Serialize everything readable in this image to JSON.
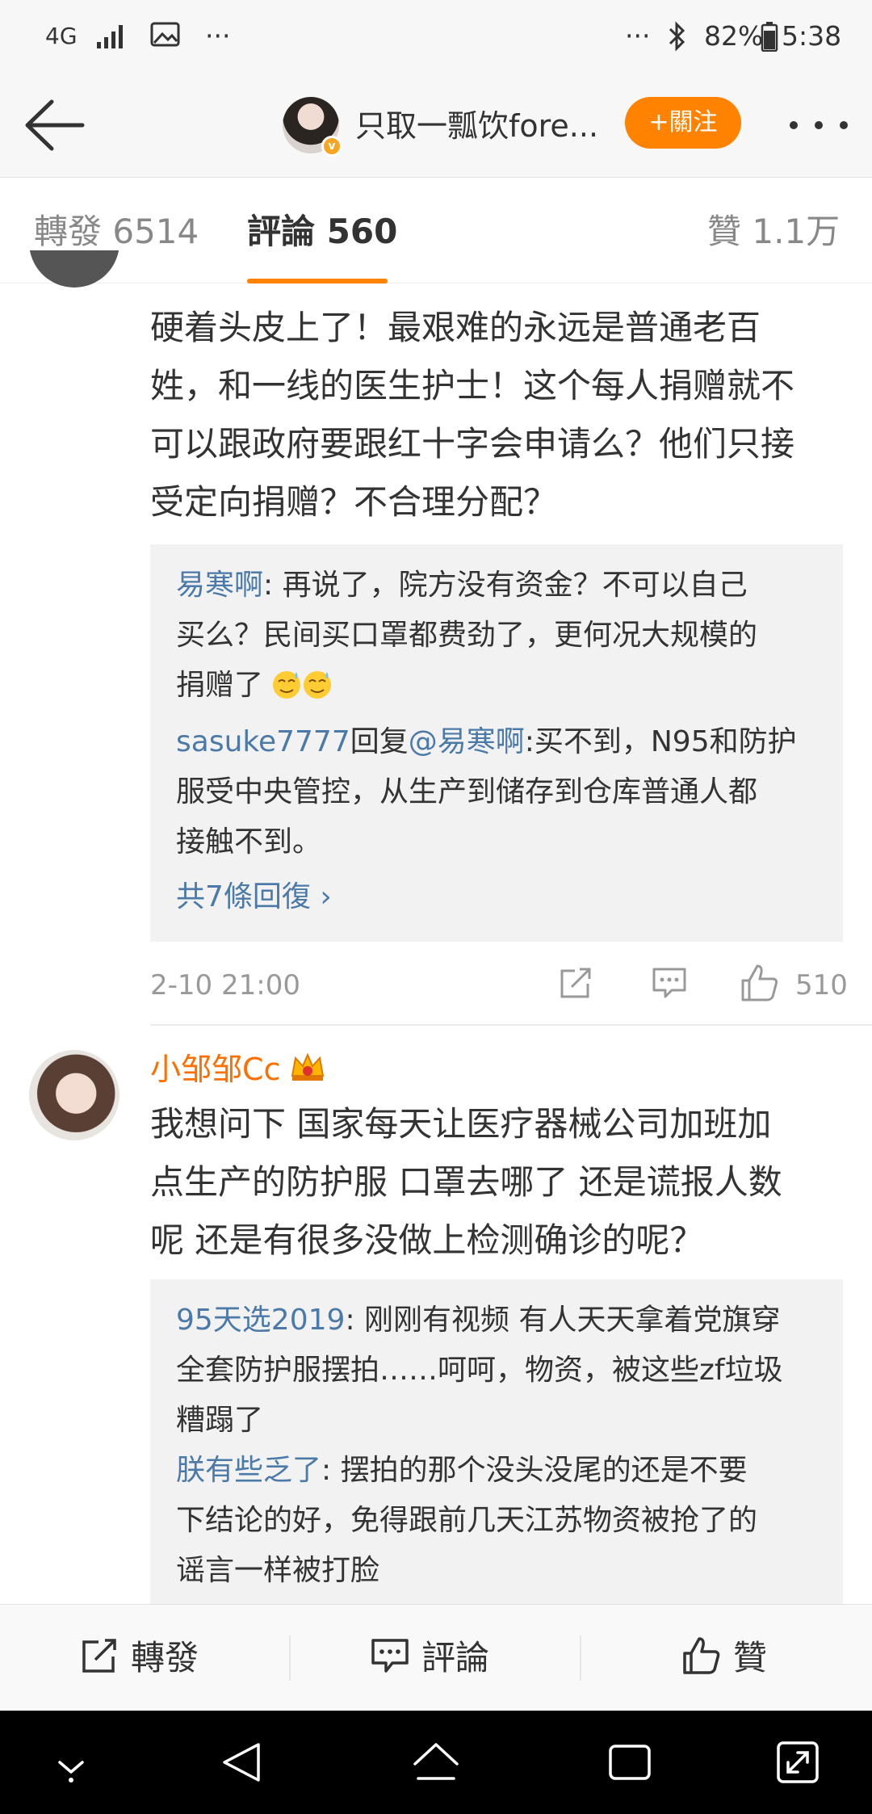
{
  "status_bar": {
    "network": "4G",
    "more_left": "···",
    "more_right": "···",
    "battery": "82%",
    "time": "5:38"
  },
  "header": {
    "title": "只取一瓢饮fore...",
    "follow_label": "+關注"
  },
  "tabs": {
    "repost": "轉發 6514",
    "comments": "評論 560",
    "likes": "贊 1.1万"
  },
  "comment1": {
    "lines": [
      "硬着头皮上了！最艰难的永远是普通老百",
      "姓，和一线的医生护士！这个每人捐赠就不",
      "可以跟政府要跟红十字会申请么？他们只接",
      "受定向捐赠？不合理分配？"
    ],
    "replies": [
      {
        "user": "易寒啊",
        "lines": [
          ": 再说了，院方没有资金？不可以自己",
          "买么？民间买口罩都费劲了，更何况大规模的",
          "捐赠了"
        ]
      },
      {
        "user": "sasuke7777",
        "reply_word": "回复",
        "target": "@易寒啊",
        "lines": [
          ":买不到，N95和防护",
          "服受中央管控，从生产到储存到仓库普通人都",
          "接触不到。"
        ]
      }
    ],
    "more_replies": "共7條回復 ›",
    "time": "2-10 21:00",
    "likes": "510"
  },
  "comment2": {
    "user": "小邹邹Cc",
    "lines": [
      "我想问下 国家每天让医疗器械公司加班加",
      "点生产的防护服 口罩去哪了 还是谎报人数",
      "呢 还是有很多没做上检测确诊的呢？"
    ],
    "replies": [
      {
        "user": "95天选2019",
        "lines": [
          ": 刚刚有视频 有人天天拿着党旗穿",
          "全套防护服摆拍……呵呵，物资，被这些zf垃圾",
          "糟蹋了"
        ]
      },
      {
        "user": "朕有些乏了",
        "lines": [
          ": 摆拍的那个没头没尾的还是不要",
          "下结论的好，免得跟前几天江苏物资被抢了的",
          "谣言一样被打脸"
        ]
      }
    ]
  },
  "bottom_bar": {
    "repost": "轉發",
    "comment": "評論",
    "like": "贊"
  },
  "colors": {
    "accent": "#ff8200",
    "username_link": "#4b7aa8",
    "vip_name": "#ff6f00"
  }
}
